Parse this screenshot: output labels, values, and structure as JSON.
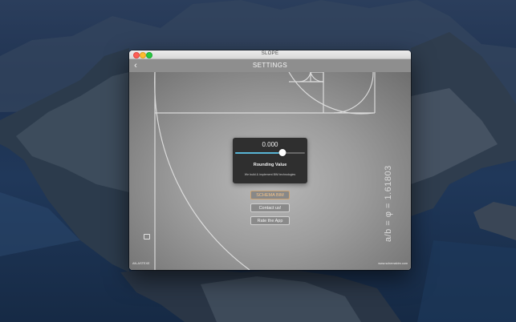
{
  "window": {
    "title": "SLOPE"
  },
  "navbar": {
    "title": "SETTINGS",
    "back_icon": "chevron-left-icon"
  },
  "rounding_panel": {
    "value": "0.000",
    "slider_level": 0.68,
    "label": "Rounding Value",
    "description": "We build & implement BIM technologies"
  },
  "buttons": {
    "schema": "SCHEMA BIM",
    "contact": "Contact us!",
    "rate": "Rate the App"
  },
  "footer": {
    "version": "AN-ASTEXE",
    "website": "www.schemabim.com"
  },
  "formula": "a/b = φ = 1.61803",
  "colors": {
    "accent": "#58b4d4",
    "schema_text": "#f6c48a",
    "navbar": "#8e8e8e"
  }
}
